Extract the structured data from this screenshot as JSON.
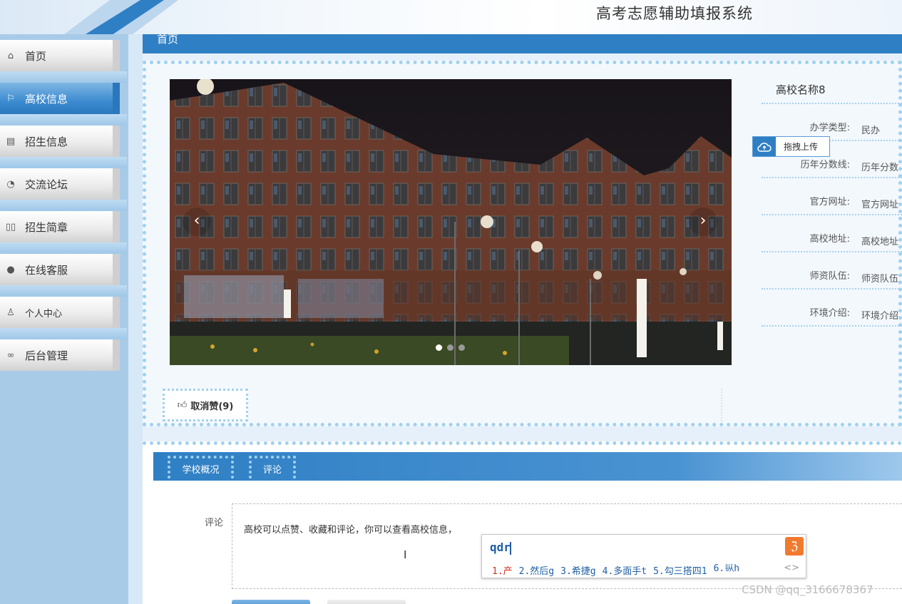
{
  "header": {
    "title": "高考志愿辅助填报系统"
  },
  "sidebar": {
    "items": [
      {
        "label": "首页",
        "icon": "home-icon"
      },
      {
        "label": "高校信息",
        "icon": "flag-icon"
      },
      {
        "label": "招生信息",
        "icon": "calendar-icon"
      },
      {
        "label": "交流论坛",
        "icon": "palette-icon"
      },
      {
        "label": "招生简章",
        "icon": "book-icon"
      },
      {
        "label": "在线客服",
        "icon": "chat-icon"
      },
      {
        "label": "个人中心",
        "icon": "user-icon"
      },
      {
        "label": "后台管理",
        "icon": "link-icon"
      }
    ],
    "active_index": 1
  },
  "breadcrumb": {
    "label": "首页"
  },
  "school": {
    "name": "高校名称8",
    "fields": [
      {
        "label": "办学类型:",
        "value": "民办"
      },
      {
        "label": "历年分数线:",
        "value": "历年分数"
      },
      {
        "label": "官方网址:",
        "value": "官方网址"
      },
      {
        "label": "高校地址:",
        "value": "高校地址"
      },
      {
        "label": "师资队伍:",
        "value": "师资队伍"
      },
      {
        "label": "环境介绍:",
        "value": "环境介绍"
      }
    ]
  },
  "carousel": {
    "slide_count": 3,
    "active_slide": 1
  },
  "upload": {
    "label": "拖拽上传"
  },
  "like": {
    "label": "取消赞(9)"
  },
  "tabs": [
    {
      "label": "学校概况"
    },
    {
      "label": "评论"
    }
  ],
  "comment": {
    "label": "评论",
    "text": "高校可以点赞、收藏和评论，你可以查看高校信息，"
  },
  "ime": {
    "input": "qdr",
    "candidates": [
      "1.产",
      "2.然后g",
      "3.希捷g",
      "4.多面手t",
      "5.勾三搭四1",
      "6.𫓩h"
    ],
    "arrows": "<>"
  },
  "watermark": "CSDN @qq_3166678367",
  "colors": {
    "primary": "#2f7fc4",
    "sidebar_bg": "#a8cbe8",
    "accent_orange": "#f07a2e"
  }
}
